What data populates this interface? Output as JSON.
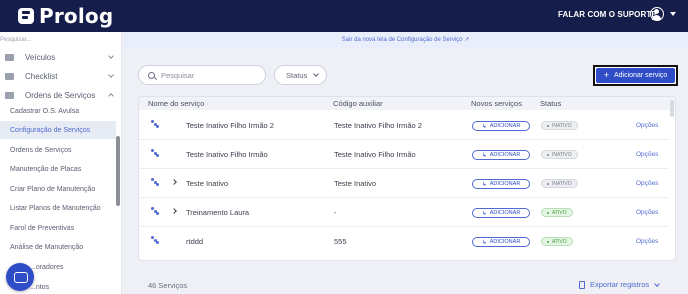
{
  "app": {
    "logo_text": "Prolog"
  },
  "topbar": {
    "support_label": "FALAR COM O SUPORTE"
  },
  "sidebar": {
    "search_placeholder": "Pesquisar...",
    "groups": [
      {
        "label": "Veículos",
        "icon": "truck-icon"
      },
      {
        "label": "Checklist",
        "icon": "checklist-icon"
      },
      {
        "label": "Ordens de Serviços",
        "icon": "wrench-icon"
      }
    ],
    "items": [
      {
        "label": "Cadastrar O.S. Avulsa"
      },
      {
        "label": "Configuração de Serviços",
        "active": true
      },
      {
        "label": "Ordens de Serviços"
      },
      {
        "label": "Manutenção de Placas"
      },
      {
        "label": "Criar Plano de Manutenção"
      },
      {
        "label": "Listar Planos de Manutenção"
      },
      {
        "label": "Farol de Preventivas"
      },
      {
        "label": "Análise de Manutenção"
      },
      {
        "label": "...oradores"
      },
      {
        "label": "...ntos"
      }
    ]
  },
  "banner": {
    "text": "Sair da nova tela de Configuração de Serviço ↗"
  },
  "toolbar": {
    "search_placeholder": "Pesquisar",
    "status_filter_label": "Status",
    "add_button_label": "Adicionar serviço"
  },
  "table": {
    "headers": {
      "name": "Nome do serviço",
      "code": "Código auxiliar",
      "new_services": "Novos serviços",
      "status": "Status"
    },
    "rows": [
      {
        "name": "Teste Inativo Filho Irmão 2",
        "code": "Teste Inativo Filho Irmão 2",
        "action": "ADICIONAR",
        "status": "INATIVO",
        "options": "Opções",
        "expandable": false
      },
      {
        "name": "Teste Inativo Filho Irmão",
        "code": "Teste Inativo Filho Irmão",
        "action": "ADICIONAR",
        "status": "INATIVO",
        "options": "Opções",
        "expandable": false
      },
      {
        "name": "Teste Inativo",
        "code": "Teste Inativo",
        "action": "ADICIONAR",
        "status": "INATIVO",
        "options": "Opções",
        "expandable": true
      },
      {
        "name": "Treinamento Laura",
        "code": "-",
        "action": "ADICIONAR",
        "status": "ATIVO",
        "options": "Opções",
        "expandable": true
      },
      {
        "name": "rtddd",
        "code": "555",
        "action": "ADICIONAR",
        "status": "ATIVO",
        "options": "Opções",
        "expandable": false
      }
    ]
  },
  "footer": {
    "count_label": "46 Serviços",
    "export_label": "Exportar registros"
  },
  "colors": {
    "topbar": "#151e4a",
    "accent": "#2f4dc7",
    "active_badge": "#4aa042"
  }
}
